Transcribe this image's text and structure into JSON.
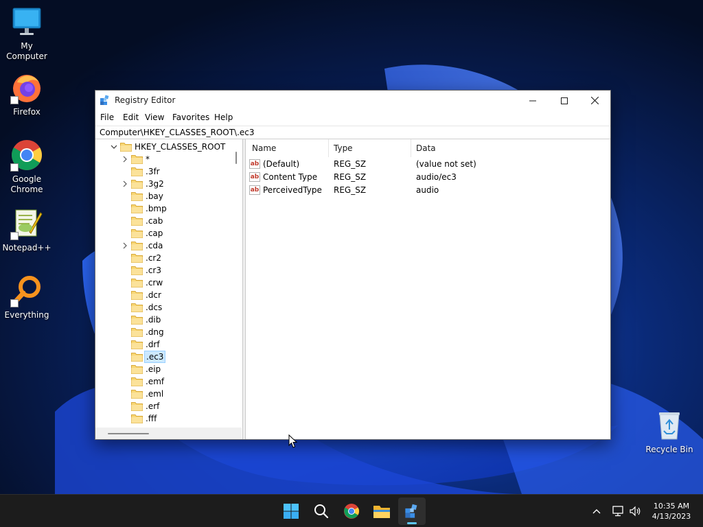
{
  "desktop": {
    "icons": [
      {
        "label_lines": [
          "My Computer"
        ]
      },
      {
        "label_lines": [
          "Firefox"
        ]
      },
      {
        "label_lines": [
          "Google",
          "Chrome"
        ]
      },
      {
        "label_lines": [
          "Notepad++"
        ]
      },
      {
        "label_lines": [
          "Everything"
        ]
      },
      {
        "label_lines": [
          "Recycle Bin"
        ]
      }
    ]
  },
  "window": {
    "title": "Registry Editor",
    "menu": [
      "File",
      "Edit",
      "View",
      "Favorites",
      "Help"
    ],
    "address": "Computer\\HKEY_CLASSES_ROOT\\.ec3",
    "tree": {
      "root": "HKEY_CLASSES_ROOT",
      "items": [
        {
          "label": "*",
          "expandable": true
        },
        {
          "label": ".3fr",
          "expandable": false
        },
        {
          "label": ".3g2",
          "expandable": true
        },
        {
          "label": ".bay",
          "expandable": false
        },
        {
          "label": ".bmp",
          "expandable": false
        },
        {
          "label": ".cab",
          "expandable": false
        },
        {
          "label": ".cap",
          "expandable": false
        },
        {
          "label": ".cda",
          "expandable": true
        },
        {
          "label": ".cr2",
          "expandable": false
        },
        {
          "label": ".cr3",
          "expandable": false
        },
        {
          "label": ".crw",
          "expandable": false
        },
        {
          "label": ".dcr",
          "expandable": false
        },
        {
          "label": ".dcs",
          "expandable": false
        },
        {
          "label": ".dib",
          "expandable": false
        },
        {
          "label": ".dng",
          "expandable": false
        },
        {
          "label": ".drf",
          "expandable": false
        },
        {
          "label": ".ec3",
          "expandable": false,
          "selected": true
        },
        {
          "label": ".eip",
          "expandable": false
        },
        {
          "label": ".emf",
          "expandable": false
        },
        {
          "label": ".eml",
          "expandable": false
        },
        {
          "label": ".erf",
          "expandable": false
        },
        {
          "label": ".fff",
          "expandable": false
        }
      ]
    },
    "values": {
      "columns": {
        "name": "Name",
        "type": "Type",
        "data": "Data"
      },
      "rows": [
        {
          "icon": "ab",
          "name": "(Default)",
          "type": "REG_SZ",
          "data": "(value not set)"
        },
        {
          "icon": "ab",
          "name": "Content Type",
          "type": "REG_SZ",
          "data": "audio/ec3"
        },
        {
          "icon": "ab",
          "name": "PerceivedType",
          "type": "REG_SZ",
          "data": "audio"
        }
      ]
    }
  },
  "taskbar": {
    "apps": [
      "start-icon",
      "search-icon",
      "chrome-icon",
      "file-explorer-icon",
      "registry-editor-icon"
    ],
    "active_app": "registry-editor-icon",
    "tray": [
      "chevron-up-icon",
      "network-icon",
      "volume-icon"
    ],
    "time": "10:35 AM",
    "date": "4/13/2023"
  },
  "colors": {
    "selection_bg": "#cce8ff",
    "folder": "#f8d775",
    "taskbar": "#1c1c1c",
    "accent": "#5ec7f8"
  }
}
